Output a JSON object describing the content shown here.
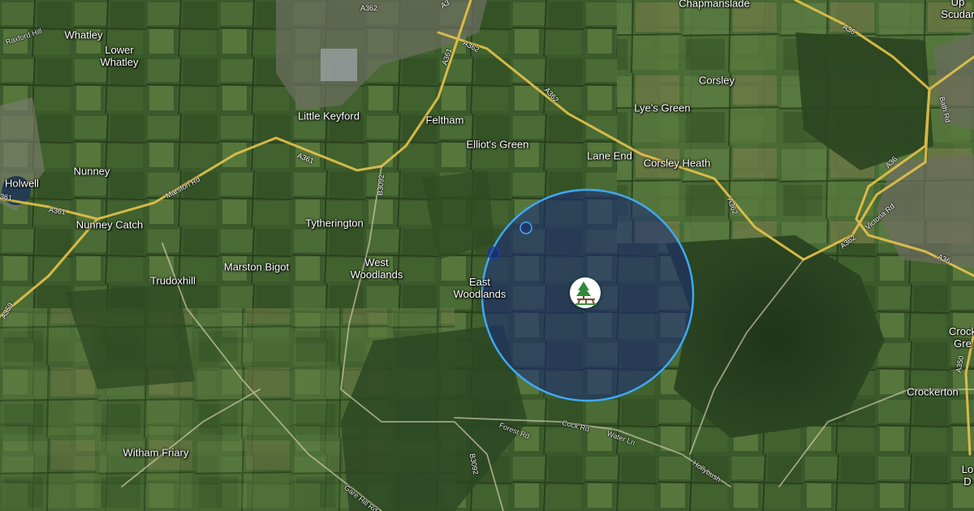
{
  "map": {
    "type": "satellite",
    "marker": {
      "icon": "picnic-site-icon",
      "radius_circle_color": "#2a3c8c",
      "ring_color": "#3fa9f5"
    },
    "places": [
      {
        "id": "chapmanslade",
        "label": "Chapmanslade"
      },
      {
        "id": "upton-scudamore",
        "label": "Up\nScudar"
      },
      {
        "id": "whatley",
        "label": "Whatley"
      },
      {
        "id": "lower-whatley",
        "label": "Lower\nWhatley"
      },
      {
        "id": "little-keyford",
        "label": "Little Keyford"
      },
      {
        "id": "feltham",
        "label": "Feltham"
      },
      {
        "id": "corsley",
        "label": "Corsley"
      },
      {
        "id": "lyes-green",
        "label": "Lye's Green"
      },
      {
        "id": "elliots-green",
        "label": "Elliot's Green"
      },
      {
        "id": "lane-end",
        "label": "Lane End"
      },
      {
        "id": "corsley-heath",
        "label": "Corsley Heath"
      },
      {
        "id": "nunney",
        "label": "Nunney"
      },
      {
        "id": "holwell",
        "label": "Holwell"
      },
      {
        "id": "nunney-catch",
        "label": "Nunney Catch"
      },
      {
        "id": "tytherington",
        "label": "Tytherington"
      },
      {
        "id": "marston-bigot",
        "label": "Marston Bigot"
      },
      {
        "id": "west-woodlands",
        "label": "West\nWoodlands"
      },
      {
        "id": "east-woodlands",
        "label": "East\nWoodlands"
      },
      {
        "id": "trudoxhill",
        "label": "Trudoxhill"
      },
      {
        "id": "crockerton",
        "label": "Crockerton"
      },
      {
        "id": "crockerton-green",
        "label": "Crock\nGre"
      },
      {
        "id": "longbridge",
        "label": "Lo\nD"
      },
      {
        "id": "witham-friary",
        "label": "Witham Friary"
      }
    ],
    "roads": [
      {
        "id": "a362-top",
        "label": "A362"
      },
      {
        "id": "a362-top2",
        "label": "A362"
      },
      {
        "id": "a3-frag",
        "label": "A3"
      },
      {
        "id": "a361-north",
        "label": "A361"
      },
      {
        "id": "a362-east",
        "label": "A362"
      },
      {
        "id": "a361-mid",
        "label": "A361"
      },
      {
        "id": "b3092-north",
        "label": "B3092"
      },
      {
        "id": "marston-rd",
        "label": "Marston Rd"
      },
      {
        "id": "a361-west",
        "label": "A361"
      },
      {
        "id": "a361-edge",
        "label": "361"
      },
      {
        "id": "a359",
        "label": "A359"
      },
      {
        "id": "a36-top",
        "label": "A36"
      },
      {
        "id": "a36-mid",
        "label": "A36"
      },
      {
        "id": "a36-east",
        "label": "A36"
      },
      {
        "id": "bath-rd",
        "label": "Bath Rd"
      },
      {
        "id": "victoria-rd",
        "label": "Victoria Rd"
      },
      {
        "id": "a362-se",
        "label": "A362"
      },
      {
        "id": "a362-south",
        "label": "A362"
      },
      {
        "id": "forest-rd",
        "label": "Forest Rd"
      },
      {
        "id": "cock-rd",
        "label": "Cock Rd"
      },
      {
        "id": "water-ln",
        "label": "Water Ln"
      },
      {
        "id": "hollybush",
        "label": "Hollybush"
      },
      {
        "id": "b3092-south",
        "label": "B3092"
      },
      {
        "id": "gare-hill-rd",
        "label": "Gare Hill Rd"
      },
      {
        "id": "a350",
        "label": "A350"
      },
      {
        "id": "raxford-hill",
        "label": "Raxford Hill"
      }
    ]
  }
}
